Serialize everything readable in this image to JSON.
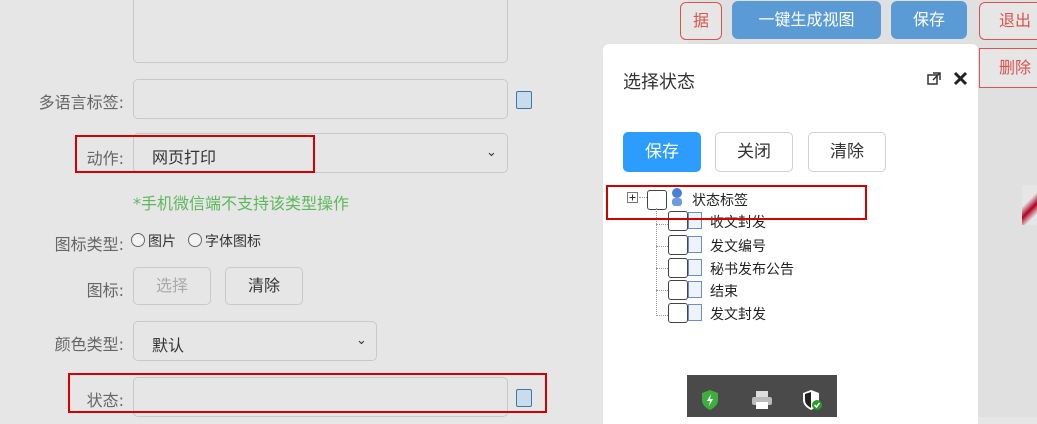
{
  "form": {
    "multilang_label": "多语言标签:",
    "action_label": "动作:",
    "action_value": "网页打印",
    "hint": "*手机微信端不支持该类型操作",
    "icon_type_label": "图标类型:",
    "icon_type_options": [
      "图片",
      "字体图标"
    ],
    "icon_label": "图标:",
    "select_button": "选择",
    "clear_button": "清除",
    "color_type_label": "颜色类型:",
    "color_type_value": "默认",
    "status_label": "状态:"
  },
  "toolbar": {
    "data_button_partial": "据",
    "generate_view_button": "一键生成视图",
    "save_button": "保存",
    "exit_button": "退出",
    "delete_button": "删除"
  },
  "modal": {
    "title": "选择状态",
    "save_button": "保存",
    "close_button": "关闭",
    "clear_button": "清除",
    "tree": {
      "root": "状态标签",
      "children": [
        "收文封发",
        "发文编号",
        "秘书发布公告",
        "结束",
        "发文封发"
      ]
    }
  },
  "colors": {
    "primary_blue": "#2d9cff",
    "toolbar_blue": "#5b9bd5",
    "danger_red": "#d9534f",
    "highlight_red": "#d40000",
    "hint_green": "#5cb85c"
  },
  "icons": [
    "clipboard-icon",
    "popout-icon",
    "close-icon",
    "expand-icon",
    "user-group-icon",
    "document-icon",
    "shield-icon",
    "printer-icon",
    "security-shield-icon"
  ]
}
